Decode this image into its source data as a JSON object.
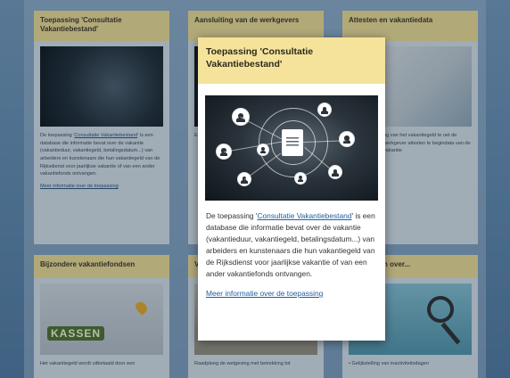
{
  "background_cards": [
    {
      "title": "Toepassing 'Consultatie Vakantiebestand'",
      "text_before": "De toepassing '",
      "text_link": "Consultatie Vakantiebestand",
      "text_after": "' is een database die informatie bevat over de vakantie (vakantieduur, vakantiegeld, betalingsdatum...) van arbeiders en kunstenaars die hun vakantiegeld van de Rijksdienst voor jaarlijkse vakantie of van een ander vakantiefonds ontvangen.",
      "more": "Meer informatie over de toepassing"
    },
    {
      "title": "Aansluiting van de werkgevers"
    },
    {
      "title": "Attesten en vakantiedata",
      "text": "ng van het vakantiegeld te oet de werkgever attesten le begindata van de vakantie"
    },
    {
      "title": "Bijzondere vakantiefondsen",
      "text": "Het vakantiegeld wordt uitbetaald door een"
    },
    {
      "title": "V",
      "text": "Raadpleeg de wetgeving met betrekking tot"
    },
    {
      "title": "n over...",
      "text": "Gelijkstelling van inactiviteitsdagen"
    }
  ],
  "middle_card_text": "E",
  "keyboard_word": "KASSEN",
  "modal": {
    "title": "Toepassing 'Consultatie Vakantiebestand'",
    "text_before": "De toepassing '",
    "text_link": "Consultatie Vakantiebestand",
    "text_after": "' is een database die informatie bevat over de vakantie (vakantieduur, vakantiegeld, betalingsdatum...) van arbeiders en kunstenaars die hun vakantiegeld van de Rijksdienst voor jaarlijkse vakantie of van een ander vakantiefonds ontvangen.",
    "more": "Meer informatie over de toepassing"
  },
  "colors": {
    "card_header": "#e7d48e",
    "modal_header": "#f5e39c",
    "link": "#1f5fa0"
  }
}
